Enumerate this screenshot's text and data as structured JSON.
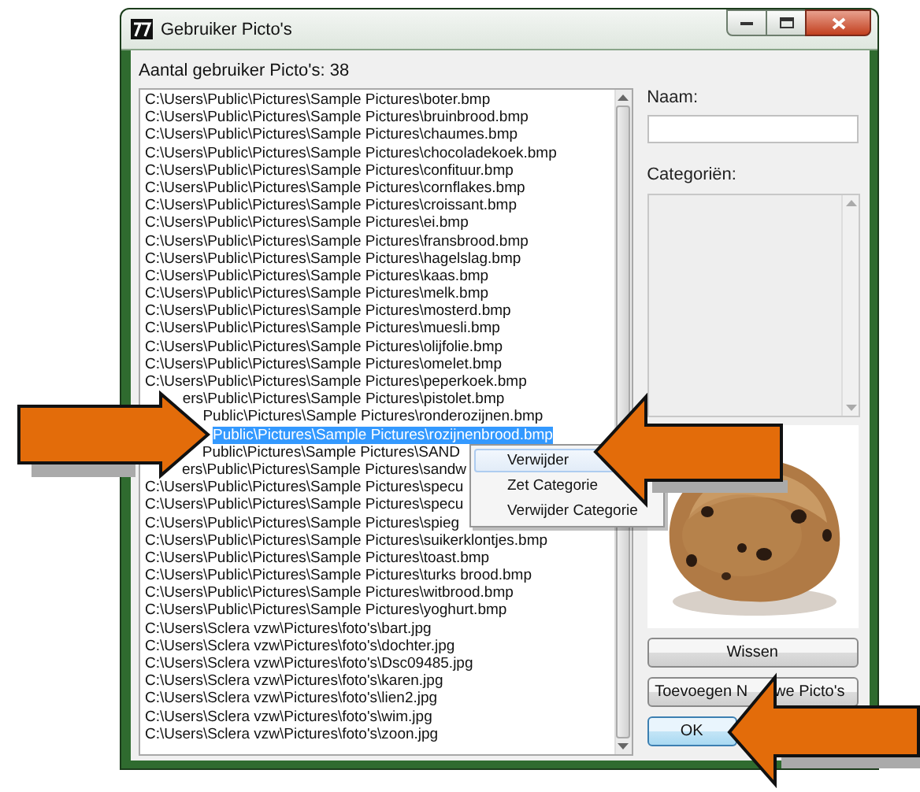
{
  "window": {
    "title": "Gebruiker Picto's"
  },
  "count_label": "Aantal gebruiker Picto's: 38",
  "files": [
    {
      "text": "C:\\Users\\Public\\Pictures\\Sample Pictures\\boter.bmp",
      "selected": false,
      "kind": "file"
    },
    {
      "text": "C:\\Users\\Public\\Pictures\\Sample Pictures\\bruinbrood.bmp",
      "selected": false,
      "kind": "file"
    },
    {
      "text": "C:\\Users\\Public\\Pictures\\Sample Pictures\\chaumes.bmp",
      "selected": false,
      "kind": "file"
    },
    {
      "text": "C:\\Users\\Public\\Pictures\\Sample Pictures\\chocoladekoek.bmp",
      "selected": false,
      "kind": "file"
    },
    {
      "text": "C:\\Users\\Public\\Pictures\\Sample Pictures\\confituur.bmp",
      "selected": false,
      "kind": "file"
    },
    {
      "text": "C:\\Users\\Public\\Pictures\\Sample Pictures\\cornflakes.bmp",
      "selected": false,
      "kind": "file"
    },
    {
      "text": "C:\\Users\\Public\\Pictures\\Sample Pictures\\croissant.bmp",
      "selected": false,
      "kind": "file"
    },
    {
      "text": "C:\\Users\\Public\\Pictures\\Sample Pictures\\ei.bmp",
      "selected": false,
      "kind": "file"
    },
    {
      "text": "C:\\Users\\Public\\Pictures\\Sample Pictures\\fransbrood.bmp",
      "selected": false,
      "kind": "file"
    },
    {
      "text": "C:\\Users\\Public\\Pictures\\Sample Pictures\\hagelslag.bmp",
      "selected": false,
      "kind": "file"
    },
    {
      "text": "C:\\Users\\Public\\Pictures\\Sample Pictures\\kaas.bmp",
      "selected": false,
      "kind": "file"
    },
    {
      "text": "C:\\Users\\Public\\Pictures\\Sample Pictures\\melk.bmp",
      "selected": false,
      "kind": "file"
    },
    {
      "text": "C:\\Users\\Public\\Pictures\\Sample Pictures\\mosterd.bmp",
      "selected": false,
      "kind": "file"
    },
    {
      "text": "C:\\Users\\Public\\Pictures\\Sample Pictures\\muesli.bmp",
      "selected": false,
      "kind": "file"
    },
    {
      "text": "C:\\Users\\Public\\Pictures\\Sample Pictures\\olijfolie.bmp",
      "selected": false,
      "kind": "file"
    },
    {
      "text": "C:\\Users\\Public\\Pictures\\Sample Pictures\\omelet.bmp",
      "selected": false,
      "kind": "file"
    },
    {
      "text": "C:\\Users\\Public\\Pictures\\Sample Pictures\\peperkoek.bmp",
      "selected": false,
      "kind": "file"
    },
    {
      "text": "ers\\Public\\Pictures\\Sample Pictures\\pistolet.bmp",
      "selected": false,
      "kind": "partly-hidden"
    },
    {
      "text": "Public\\Pictures\\Sample Pictures\\ronderozijnen.bmp",
      "selected": false,
      "kind": "partly-hidden"
    },
    {
      "text": "Public\\Pictures\\Sample Pictures\\rozijnenbrood.bmp",
      "selected": true,
      "kind": "partly-hidden"
    },
    {
      "text": "Public\\Pictures\\Sample Pictures\\SAND",
      "selected": false,
      "kind": "partly-hidden"
    },
    {
      "text": "ers\\Public\\Pictures\\Sample Pictures\\sandw",
      "selected": false,
      "kind": "partly-hidden"
    },
    {
      "text": "C:\\Users\\Public\\Pictures\\Sample Pictures\\specu",
      "selected": false,
      "kind": "file"
    },
    {
      "text": "C:\\Users\\Public\\Pictures\\Sample Pictures\\specu",
      "selected": false,
      "kind": "file"
    },
    {
      "text": "C:\\Users\\Public\\Pictures\\Sample Pictures\\spieg",
      "selected": false,
      "kind": "file"
    },
    {
      "text": "C:\\Users\\Public\\Pictures\\Sample Pictures\\suikerklontjes.bmp",
      "selected": false,
      "kind": "file"
    },
    {
      "text": "C:\\Users\\Public\\Pictures\\Sample Pictures\\toast.bmp",
      "selected": false,
      "kind": "file"
    },
    {
      "text": "C:\\Users\\Public\\Pictures\\Sample Pictures\\turks brood.bmp",
      "selected": false,
      "kind": "file"
    },
    {
      "text": "C:\\Users\\Public\\Pictures\\Sample Pictures\\witbrood.bmp",
      "selected": false,
      "kind": "file"
    },
    {
      "text": "C:\\Users\\Public\\Pictures\\Sample Pictures\\yoghurt.bmp",
      "selected": false,
      "kind": "file"
    },
    {
      "text": "C:\\Users\\Sclera vzw\\Pictures\\foto's\\bart.jpg",
      "selected": false,
      "kind": "file"
    },
    {
      "text": "C:\\Users\\Sclera vzw\\Pictures\\foto's\\dochter.jpg",
      "selected": false,
      "kind": "file"
    },
    {
      "text": "C:\\Users\\Sclera vzw\\Pictures\\foto's\\Dsc09485.jpg",
      "selected": false,
      "kind": "file"
    },
    {
      "text": "C:\\Users\\Sclera vzw\\Pictures\\foto's\\karen.jpg",
      "selected": false,
      "kind": "file"
    },
    {
      "text": "C:\\Users\\Sclera vzw\\Pictures\\foto's\\lien2.jpg",
      "selected": false,
      "kind": "file"
    },
    {
      "text": "C:\\Users\\Sclera vzw\\Pictures\\foto's\\wim.jpg",
      "selected": false,
      "kind": "file"
    },
    {
      "text": "C:\\Users\\Sclera vzw\\Pictures\\foto's\\zoon.jpg",
      "selected": false,
      "kind": "file"
    }
  ],
  "context_menu": [
    {
      "label": "Verwijder",
      "selected": true
    },
    {
      "label": "Zet Categorie",
      "selected": false
    },
    {
      "label": "Verwijder Categorie",
      "selected": false
    }
  ],
  "name_field": {
    "label": "Naam:"
  },
  "categories": {
    "label": "Categoriën:"
  },
  "buttons": [
    {
      "label": "Wissen",
      "default": false
    },
    {
      "label_parts": [
        "Toevoegen N",
        "we Picto's"
      ],
      "default": false
    },
    {
      "label": "OK",
      "default": true
    }
  ],
  "annotations": [
    {
      "kind": "arrow-right"
    },
    {
      "kind": "arrow-left"
    },
    {
      "kind": "arrow-left"
    }
  ]
}
